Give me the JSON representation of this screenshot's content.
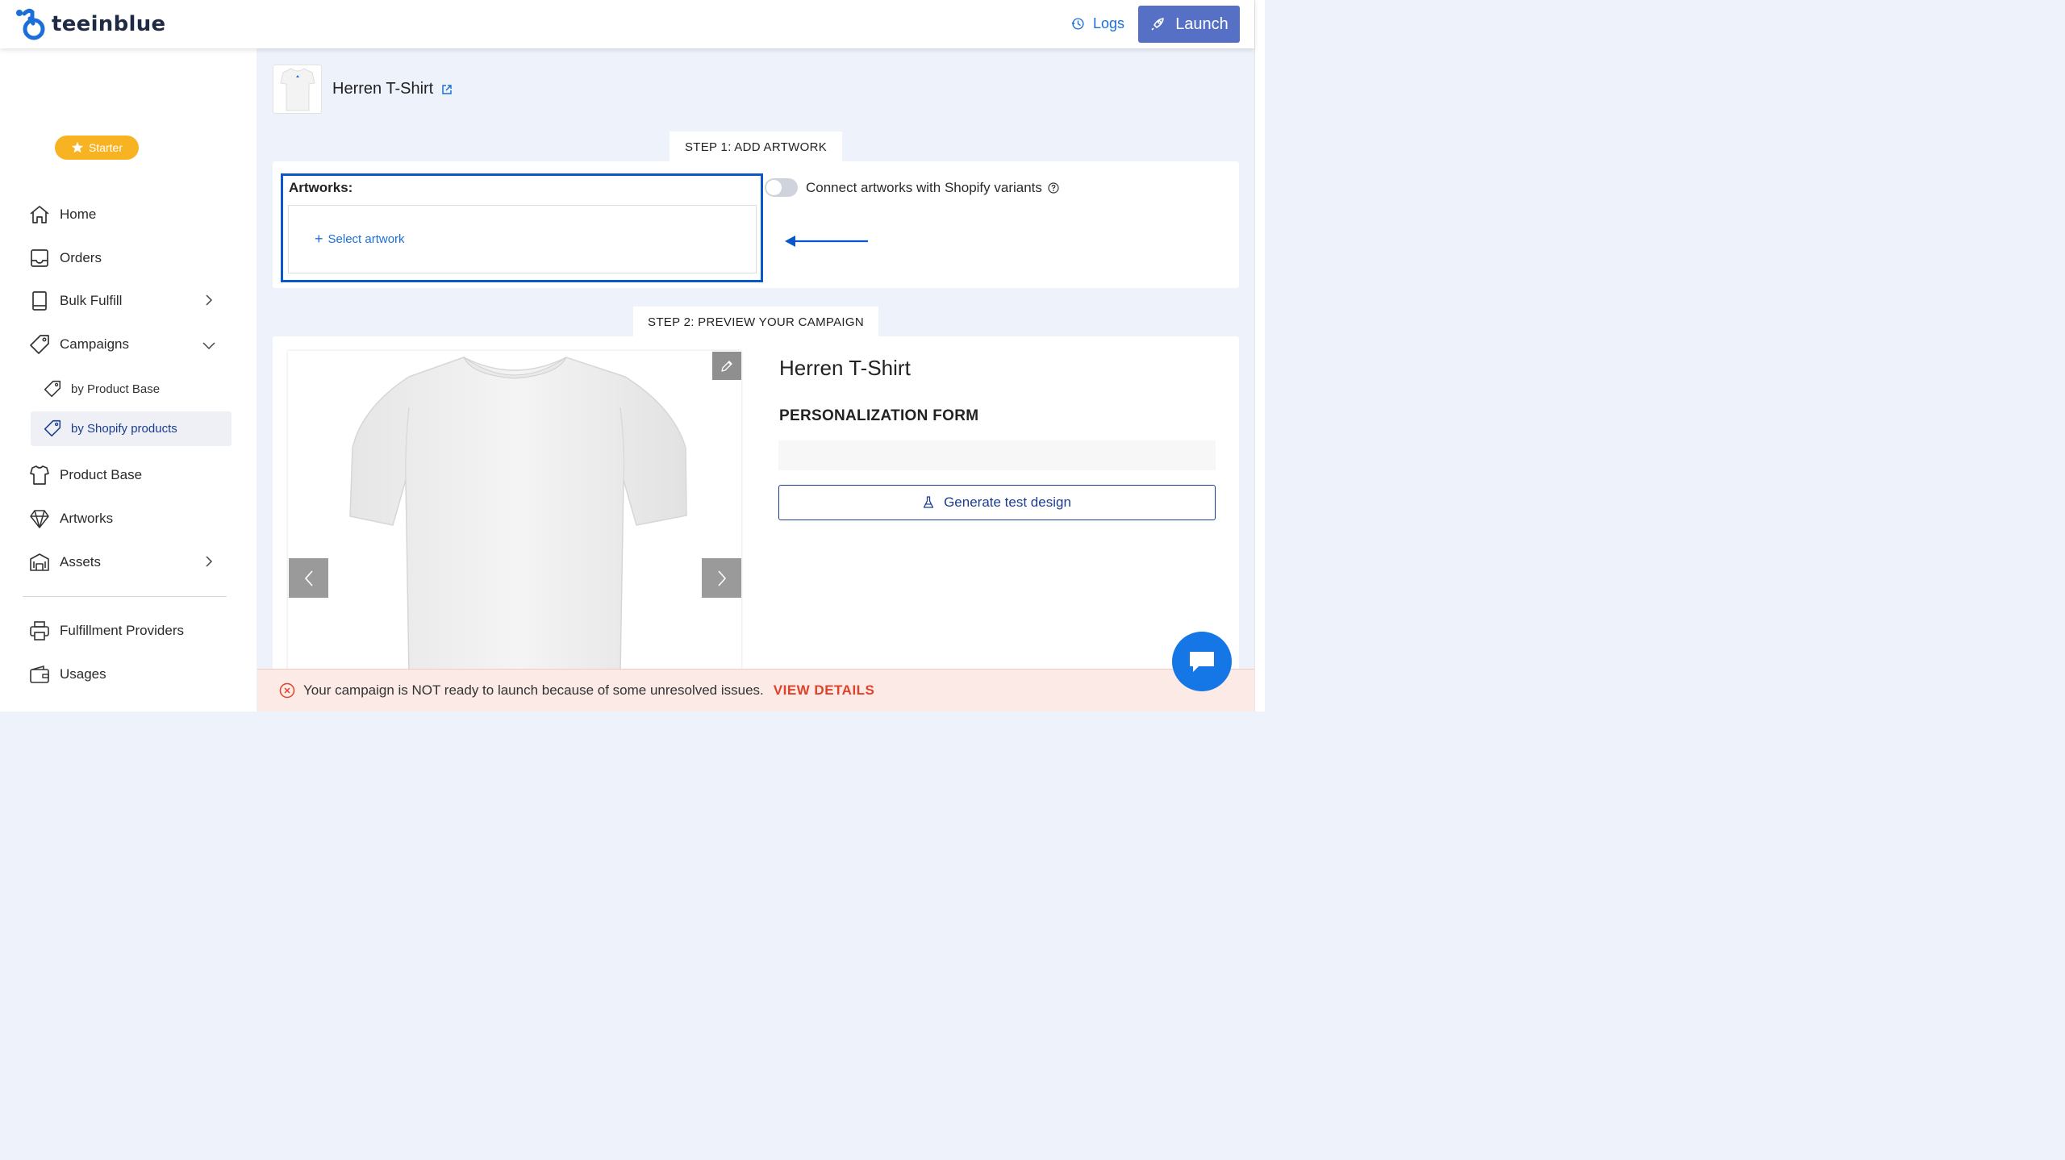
{
  "header": {
    "brand": "teeinblue",
    "logs_label": "Logs",
    "launch_label": "Launch"
  },
  "sidebar": {
    "plan_badge": "Starter",
    "items": [
      {
        "label": "Home",
        "icon": "home-icon"
      },
      {
        "label": "Orders",
        "icon": "inbox-icon"
      },
      {
        "label": "Bulk Fulfill",
        "icon": "book-icon",
        "expandable": true
      },
      {
        "label": "Campaigns",
        "icon": "tag-icon",
        "expanded": true
      },
      {
        "label": "Product Base",
        "icon": "shirt-icon"
      },
      {
        "label": "Artworks",
        "icon": "diamond-icon"
      },
      {
        "label": "Assets",
        "icon": "bank-icon",
        "expandable": true
      },
      {
        "label": "Fulfillment Providers",
        "icon": "printer-icon"
      },
      {
        "label": "Usages",
        "icon": "wallet-icon"
      }
    ],
    "campaign_sub": [
      {
        "label": "by Product Base",
        "active": false
      },
      {
        "label": "by Shopify products",
        "active": true
      }
    ]
  },
  "main": {
    "product_title": "Herren T-Shirt",
    "step1": {
      "label": "STEP 1: ADD ARTWORK",
      "artworks_label": "Artworks:",
      "select_label": "Select artwork",
      "connect_label": "Connect artworks with Shopify variants",
      "connect_enabled": false
    },
    "step2": {
      "label": "STEP 2: PREVIEW YOUR CAMPAIGN",
      "title": "Herren T-Shirt",
      "form_title": "PERSONALIZATION FORM",
      "generate_label": "Generate test design"
    }
  },
  "alert": {
    "message": "Your campaign is NOT ready to launch because of some unresolved issues.",
    "action": "VIEW DETAILS"
  },
  "colors": {
    "primary_blue": "#1c6fd9",
    "launch_bg": "#5570c4",
    "badge": "#f7b321",
    "alert_action": "#e0412a",
    "highlight_border": "#0b56c9"
  }
}
